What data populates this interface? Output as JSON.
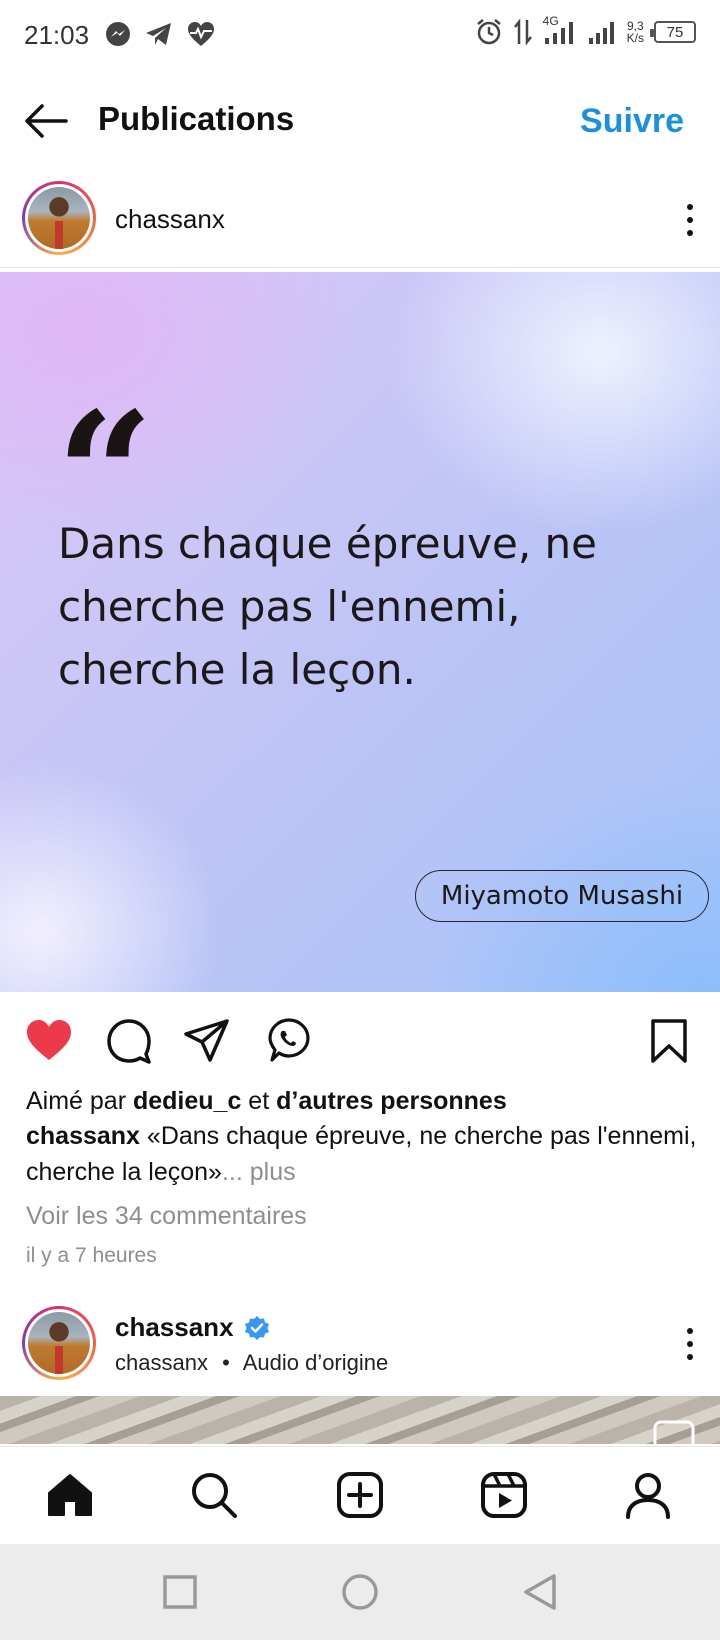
{
  "status_bar": {
    "time": "21:03",
    "network_type": "4G",
    "speed_value": "9,3",
    "speed_unit": "K/s",
    "battery": "75"
  },
  "header": {
    "title": "Publications",
    "follow_label": "Suivre"
  },
  "post": {
    "username": "chassanx",
    "quote_mark": "“",
    "quote_text": "Dans chaque épreuve, ne cherche pas l'ennemi, cherche la leçon.",
    "author": "Miyamoto Musashi",
    "likes_prefix": "Aimé par ",
    "likes_user": "dedieu_c",
    "likes_mid": " et ",
    "likes_others": "d’autres personnes",
    "caption_user": "chassanx",
    "caption_text": " «Dans chaque épreuve, ne cherche pas l'ennemi, cherche la leçon»",
    "more_label": "... plus",
    "comments_label": "Voir les 34 commentaires",
    "time_ago": "il y a 7 heures"
  },
  "post2": {
    "username": "chassanx",
    "sub_user": "chassanx",
    "separator": "•",
    "audio": "Audio d’origine"
  },
  "colors": {
    "accent": "#1a91e0",
    "like": "#ed3a4a",
    "verified": "#3897f0"
  },
  "icons": {
    "back": "arrow-left-icon",
    "like": "heart-filled-icon",
    "comment": "comment-icon",
    "share": "paper-plane-icon",
    "whatsapp": "whatsapp-icon",
    "save": "bookmark-icon",
    "nav": [
      "home-icon",
      "search-icon",
      "create-icon",
      "reels-icon",
      "profile-icon"
    ]
  }
}
